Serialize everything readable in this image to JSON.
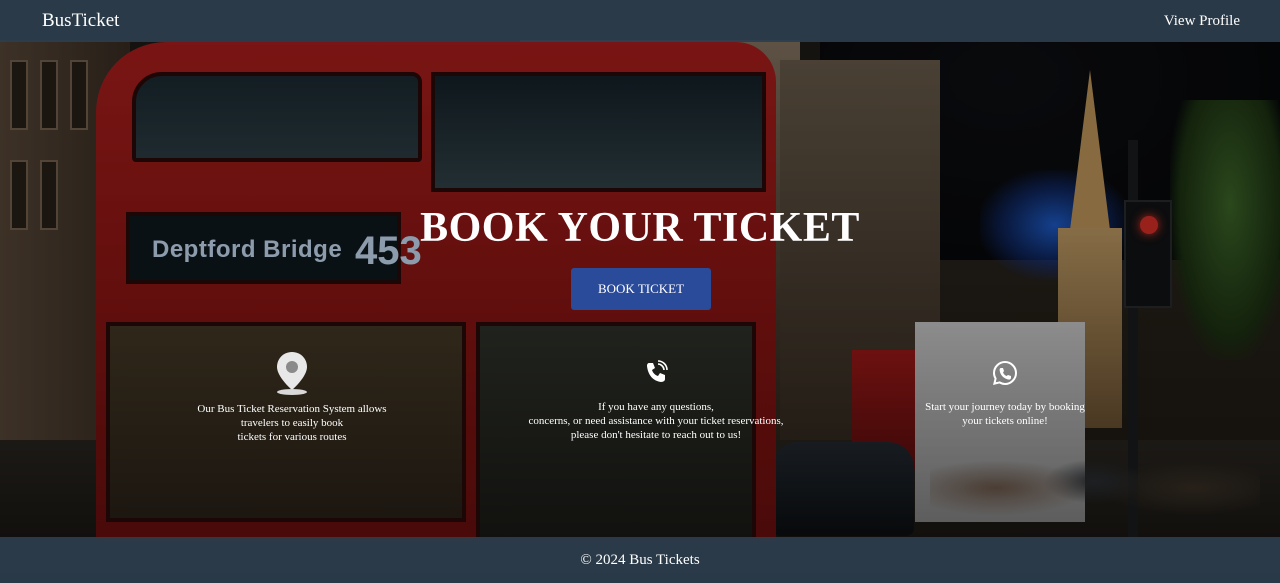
{
  "header": {
    "brand": "BusTicket",
    "view_profile_label": "View Profile"
  },
  "hero": {
    "title": "BOOK YOUR TICKET",
    "button_label": "BOOK TICKET",
    "background_sign_text": "Deptford Bridge",
    "background_bus_number": "453"
  },
  "features": [
    {
      "icon": "location-pin-icon",
      "text": "Our Bus Ticket Reservation System allows\ntravelers to easily book\ntickets for various routes"
    },
    {
      "icon": "phone-icon",
      "text": "If you have any questions,\nconcerns, or need assistance with your ticket reservations,\nplease don't hesitate to reach out to us!"
    },
    {
      "icon": "whatsapp-icon",
      "text": "Start your journey today by booking\nyour tickets online!"
    }
  ],
  "footer": {
    "text": "© 2024 Bus Tickets"
  },
  "colors": {
    "navbar": "#2c3e4e",
    "button": "#2a4a9a",
    "text": "#ffffff"
  }
}
